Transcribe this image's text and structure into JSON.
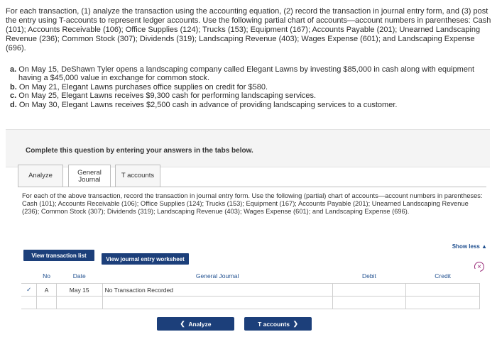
{
  "intro": "For each transaction, (1) analyze the transaction using the accounting equation, (2) record the transaction in journal entry form, and (3) post the entry using T-accounts to represent ledger accounts. Use the following partial chart of accounts—account numbers in parentheses: Cash (101); Accounts Receivable (106); Office Supplies (124); Trucks (153); Equipment (167); Accounts Payable (201); Unearned Landscaping Revenue (236); Common Stock (307); Dividends (319); Landscaping Revenue (403); Wages Expense (601); and Landscaping Expense (696).",
  "items": [
    {
      "letter": "a.",
      "text": "On May 15, DeShawn Tyler opens a landscaping company called Elegant Lawns by investing $85,000 in cash along with equipment having a $45,000 value in exchange for common stock."
    },
    {
      "letter": "b.",
      "text": "On May 21, Elegant Lawns purchases office supplies on credit for $580."
    },
    {
      "letter": "c.",
      "text": "On May 25, Elegant Lawns receives $9,300 cash for performing landscaping services."
    },
    {
      "letter": "d.",
      "text": "On May 30, Elegant Lawns receives $2,500 cash in advance of providing landscaping services to a customer."
    }
  ],
  "complete_text": "Complete this question by entering your answers in the tabs below.",
  "tabs": {
    "analyze": "Analyze",
    "general_journal": "General Journal",
    "t_accounts": "T accounts"
  },
  "panel_text": "For each of the above transaction, record the transaction in journal entry form. Use the following (partial) chart of accounts—account numbers in parentheses: Cash (101); Accounts Receivable (106); Office Supplies (124); Trucks (153); Equipment (167); Accounts Payable (201); Unearned Landscaping Revenue (236); Common Stock (307); Dividends (319); Landscaping Revenue (403); Wages Expense (601); and Landscaping Expense (696).",
  "show_less": "Show less",
  "buttons": {
    "view_transaction_list": "View transaction list",
    "view_journal_entry_worksheet": "View journal entry worksheet",
    "prev_analyze": "Analyze",
    "next_t_accounts": "T accounts"
  },
  "table": {
    "headers": {
      "no": "No",
      "date": "Date",
      "general_journal": "General Journal",
      "debit": "Debit",
      "credit": "Credit"
    },
    "rows": [
      {
        "check": "✓",
        "no": "A",
        "date": "May 15",
        "general_journal": "No Transaction Recorded",
        "debit": "",
        "credit": ""
      }
    ]
  },
  "colors": {
    "accent": "#1c3f7a",
    "close_icon": "#9a2c7a",
    "link": "#1f4f8f"
  }
}
